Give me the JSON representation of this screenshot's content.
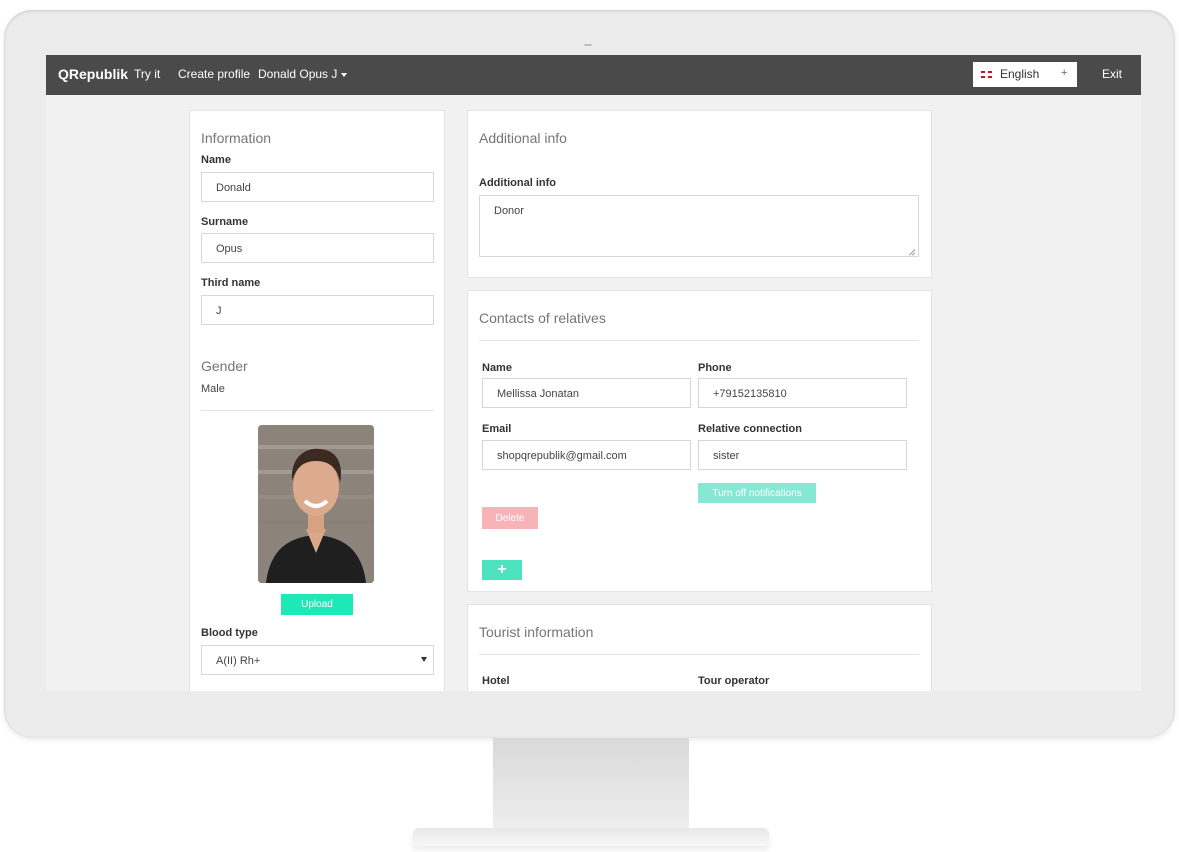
{
  "navbar": {
    "brand": "QRepublik",
    "try_it": "Try it",
    "create_profile": "Create profile",
    "user_menu": "Donald Opus J",
    "language": "English",
    "language_arrow": "+",
    "exit": "Exit"
  },
  "information": {
    "title": "Information",
    "name_label": "Name",
    "name_value": "Donald",
    "surname_label": "Surname",
    "surname_value": "Opus",
    "third_name_label": "Third name",
    "third_name_value": "J",
    "gender_title": "Gender",
    "gender_value": "Male",
    "upload_button": "Upload",
    "blood_type_label": "Blood type",
    "blood_type_value": "A(II) Rh+"
  },
  "additional": {
    "title": "Additional info",
    "label": "Additional info",
    "value": "Donor"
  },
  "relatives": {
    "title": "Contacts of relatives",
    "name_label": "Name",
    "name_value": "Mellissa Jonatan",
    "phone_label": "Phone",
    "phone_value": "+79152135810",
    "email_label": "Email",
    "email_value": "shopqrepublik@gmail.com",
    "relation_label": "Relative connection",
    "relation_value": "sister",
    "notifications_button": "Turn off notifications",
    "delete_button": "Delete",
    "add_button": "+"
  },
  "tourist": {
    "title": "Tourist information",
    "hotel_label": "Hotel",
    "tour_operator_label": "Tour operator"
  },
  "colors": {
    "navbar": "#4a4a4a",
    "accent": "#1de9b6",
    "accent_light": "#84e8d2",
    "danger_light": "#f7b3b7"
  }
}
